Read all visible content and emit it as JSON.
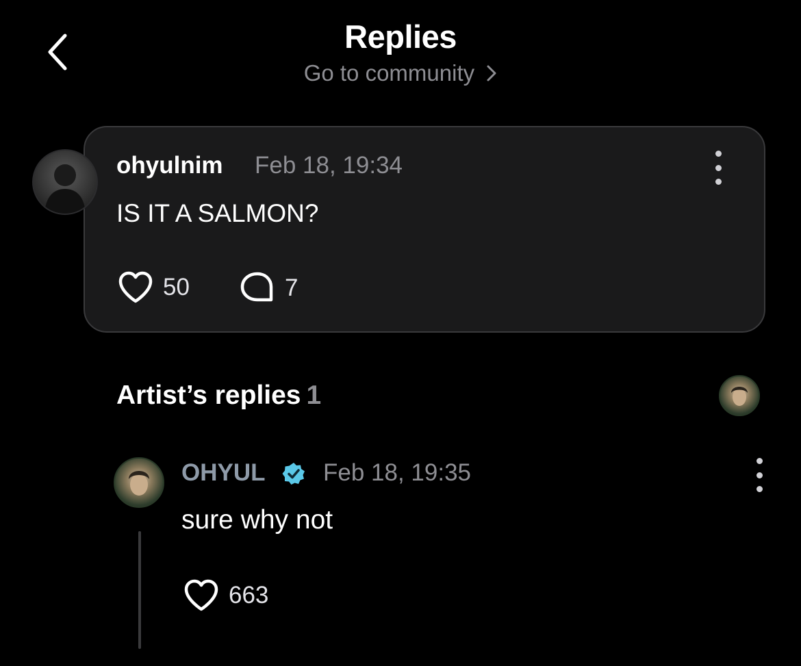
{
  "header": {
    "title": "Replies",
    "community_link": "Go to community",
    "back_icon": "chevron-left-icon",
    "link_icon": "chevron-right-icon"
  },
  "post": {
    "username": "ohyulnim",
    "timestamp": "Feb 18, 19:34",
    "text": "IS IT A SALMON?",
    "likes": "50",
    "comments": "7"
  },
  "artist_replies": {
    "title": "Artist’s replies",
    "count": "1",
    "replies": [
      {
        "username": "OHYUL",
        "verified": true,
        "timestamp": "Feb 18, 19:35",
        "text": "sure why not",
        "likes": "663"
      }
    ]
  },
  "colors": {
    "background": "#000000",
    "card": "#1a1a1b",
    "muted": "#8e8e93",
    "verified": "#5ac8e8"
  }
}
